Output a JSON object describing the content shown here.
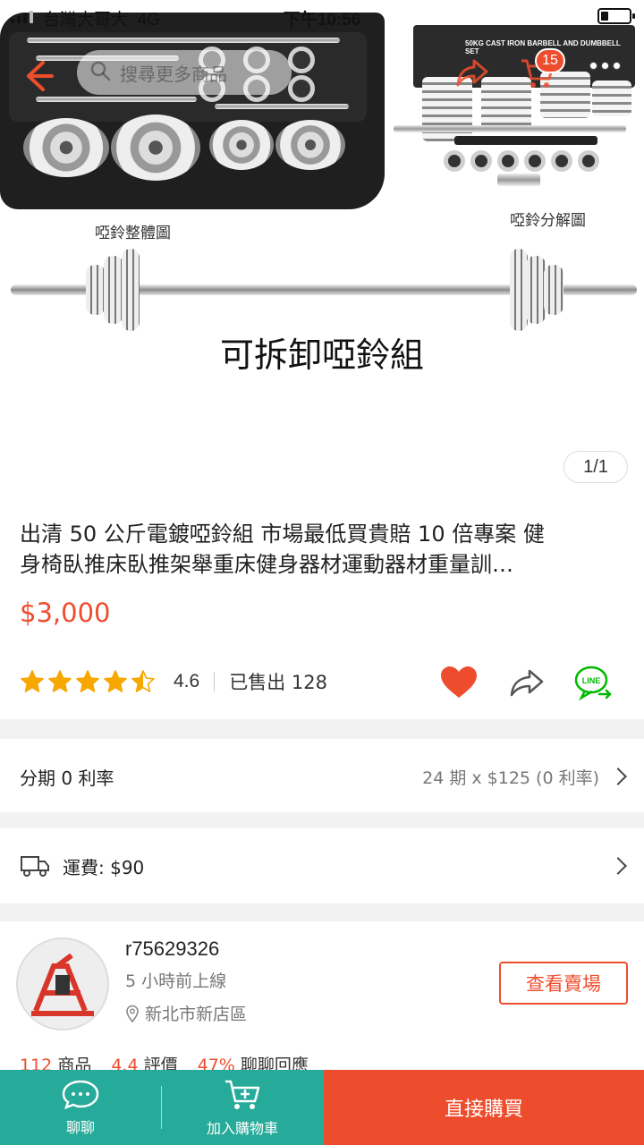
{
  "status_bar": {
    "carrier": "台灣大哥大",
    "network": "4G",
    "time": "下午10:56"
  },
  "header": {
    "search_placeholder": "搜尋更多商品",
    "cart_count": "15",
    "icons": [
      "back-arrow-icon",
      "search-icon",
      "share-icon",
      "cart-icon",
      "more-icon"
    ]
  },
  "gallery": {
    "caption_assembled": "啞鈴整體圖",
    "caption_parts": "啞鈴分解圖",
    "box_label": "50KG CAST IRON BARBELL AND DUMBBELL SET",
    "caption_main": "可拆卸啞鈴組",
    "counter": "1/1"
  },
  "product": {
    "title_line1": "出清 50 公斤電鍍啞鈴組  市場最低買貴賠 10 倍專案 健",
    "title_line2": "身椅臥推床臥推架舉重床健身器材運動器材重量訓…",
    "price": "$3,000",
    "rating_stars": 4.5,
    "rating": "4.6",
    "sold": "已售出 128"
  },
  "installment": {
    "label": "分期 0 利率",
    "value": "24 期 x $125 (0 利率)"
  },
  "shipping": {
    "label": "運費: $90"
  },
  "seller": {
    "name": "r75629326",
    "online": "5 小時前上線",
    "location": "新北市新店區",
    "view_shop": "查看賣場",
    "products_num": "112",
    "products_label": "商品",
    "rating_num": "4.4",
    "rating_label": "評價",
    "response_num": "47%",
    "response_label": "聊聊回應"
  },
  "bottom_bar": {
    "chat": "聊聊",
    "add_cart": "加入購物車",
    "buy_now": "直接購買"
  },
  "colors": {
    "accent": "#ee4d2d",
    "teal": "#26aa99",
    "star": "#f6a700",
    "line_green": "#00b900"
  }
}
